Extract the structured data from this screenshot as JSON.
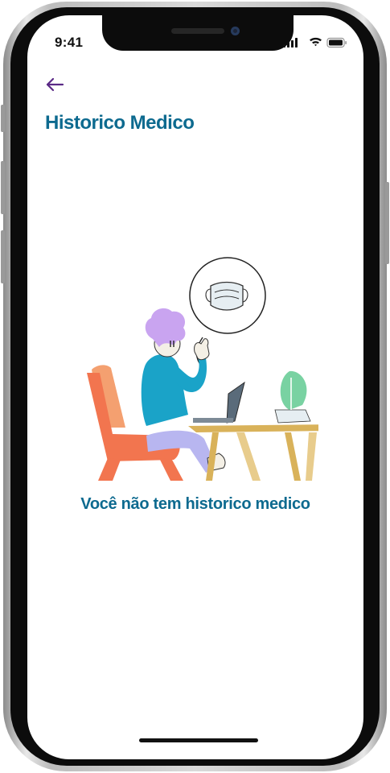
{
  "status_bar": {
    "time": "9:41",
    "icons": [
      "cellular-signal-icon",
      "wifi-icon",
      "battery-icon"
    ]
  },
  "header": {
    "back_icon": "arrow-left-icon",
    "title": "Historico Medico"
  },
  "empty_state": {
    "illustration": "person-at-laptop-with-mask-illustration",
    "message": "Você não tem historico medico"
  },
  "colors": {
    "title": "#0d6a8f",
    "back_arrow": "#5b2a86",
    "chair": "#f2754f",
    "shirt": "#1aa3c8",
    "hair": "#c9a4f0",
    "table": "#d9b25a",
    "plant": "#79d2a2"
  }
}
